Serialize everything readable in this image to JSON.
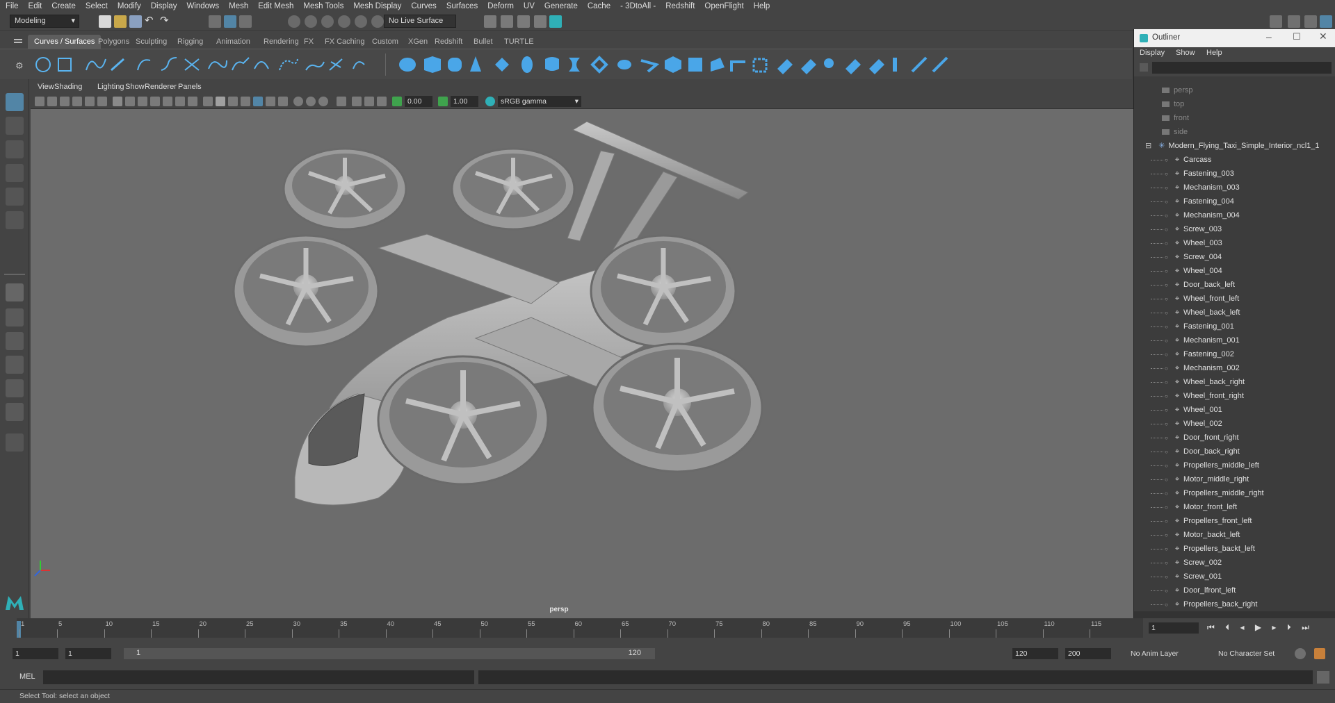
{
  "menus": [
    "File",
    "Edit",
    "Create",
    "Select",
    "Modify",
    "Display",
    "Windows",
    "Mesh",
    "Edit Mesh",
    "Mesh Tools",
    "Mesh Display",
    "Curves",
    "Surfaces",
    "Deform",
    "UV",
    "Generate",
    "Cache",
    "- 3DtoAll -",
    "Redshift",
    "OpenFlight",
    "Help"
  ],
  "statusline": {
    "mode": "Modeling",
    "live_surface": "No Live Surface"
  },
  "shelf_tabs": [
    "Curves / Surfaces",
    "Polygons",
    "Sculpting",
    "Rigging",
    "Animation",
    "Rendering",
    "FX",
    "FX Caching",
    "Custom",
    "XGen",
    "Redshift",
    "Bullet",
    "TURTLE"
  ],
  "active_shelf_tab": "Curves / Surfaces",
  "viewport": {
    "menus": [
      "View",
      "Shading",
      "Lighting",
      "Show",
      "Renderer",
      "Panels"
    ],
    "near_value": "0.00",
    "far_value": "1.00",
    "color_space": "sRGB gamma",
    "camera_label": "persp"
  },
  "outliner": {
    "title": "Outliner",
    "menus": [
      "Display",
      "Show",
      "Help"
    ],
    "cameras": [
      "persp",
      "top",
      "front",
      "side"
    ],
    "root": "Modern_Flying_Taxi_Simple_Interior_ncl1_1",
    "items": [
      "Carcass",
      "Fastening_003",
      "Mechanism_003",
      "Fastening_004",
      "Mechanism_004",
      "Screw_003",
      "Wheel_003",
      "Screw_004",
      "Wheel_004",
      "Door_back_left",
      "Wheel_front_left",
      "Wheel_back_left",
      "Fastening_001",
      "Mechanism_001",
      "Fastening_002",
      "Mechanism_002",
      "Wheel_back_right",
      "Wheel_front_right",
      "Wheel_001",
      "Wheel_002",
      "Door_front_right",
      "Door_back_right",
      "Propellers_middle_left",
      "Motor_middle_right",
      "Propellers_middle_right",
      "Motor_front_left",
      "Propellers_front_left",
      "Motor_backt_left",
      "Propellers_backt_left",
      "Screw_002",
      "Screw_001",
      "Door_lfront_left",
      "Propellers_back_right"
    ]
  },
  "timeline": {
    "ticks": [
      "1",
      "5",
      "10",
      "15",
      "20",
      "25",
      "30",
      "35",
      "40",
      "45",
      "50",
      "55",
      "60",
      "65",
      "70",
      "75",
      "80",
      "85",
      "90",
      "95",
      "100",
      "105",
      "110",
      "115"
    ],
    "current_frame": "1"
  },
  "range": {
    "start": "1",
    "playback_start": "1",
    "slider_start": "1",
    "slider_end": "120",
    "playback_end": "120",
    "end": "200",
    "anim_layer": "No Anim Layer",
    "character_set": "No Character Set"
  },
  "command": {
    "lang": "MEL"
  },
  "help_text": "Select Tool: select an object",
  "colors": {
    "accent": "#5285a6",
    "teal": "#2fb0b7",
    "panel": "#444444",
    "viewport": "#6c6c6c"
  }
}
